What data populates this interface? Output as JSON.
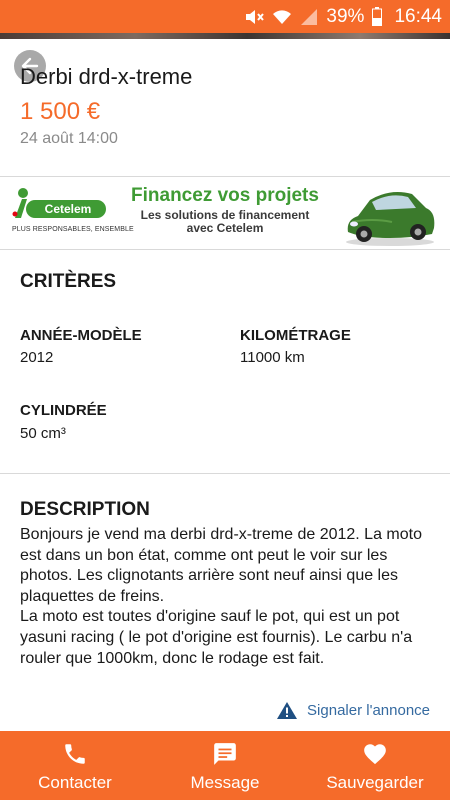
{
  "status_bar": {
    "battery": "39%",
    "time": "16:44",
    "icons": [
      "mute-icon",
      "wifi-icon",
      "signal-icon",
      "battery-icon"
    ]
  },
  "ad": {
    "title": "Derbi drd-x-treme",
    "price": "1 500 €",
    "date": "24 août 14:00"
  },
  "banner": {
    "brand": "Cetelem",
    "tagline": "PLUS RESPONSABLES, ENSEMBLE",
    "headline": "Financez vos projets",
    "sub_line1": "Les solutions de financement",
    "sub_line2": "avec Cetelem"
  },
  "criteria": {
    "title": "CRITÈRES",
    "items": [
      {
        "label": "ANNÉE-MODÈLE",
        "value": "2012"
      },
      {
        "label": "KILOMÉTRAGE",
        "value": "11000 km"
      },
      {
        "label": "CYLINDRÉE",
        "value": "50 cm³"
      }
    ]
  },
  "description": {
    "title": "DESCRIPTION",
    "paragraph1": "Bonjours je vend ma derbi drd-x-treme de 2012. La moto est dans un bon état, comme ont peut le voir sur les photos. Les clignotants arrière sont neuf ainsi que les plaquettes de freins.",
    "paragraph2": "La moto est toutes d'origine sauf le pot, qui est un pot yasuni racing ( le pot d'origine est fournis). Le carbu n'a rouler que 1000km, donc le rodage est fait."
  },
  "report": {
    "label": "Signaler l'annonce"
  },
  "actions": {
    "contact": "Contacter",
    "message": "Message",
    "save": "Sauvegarder"
  },
  "colors": {
    "accent": "#f56b2a",
    "link": "#356aa0",
    "banner_green": "#3f9b34"
  }
}
